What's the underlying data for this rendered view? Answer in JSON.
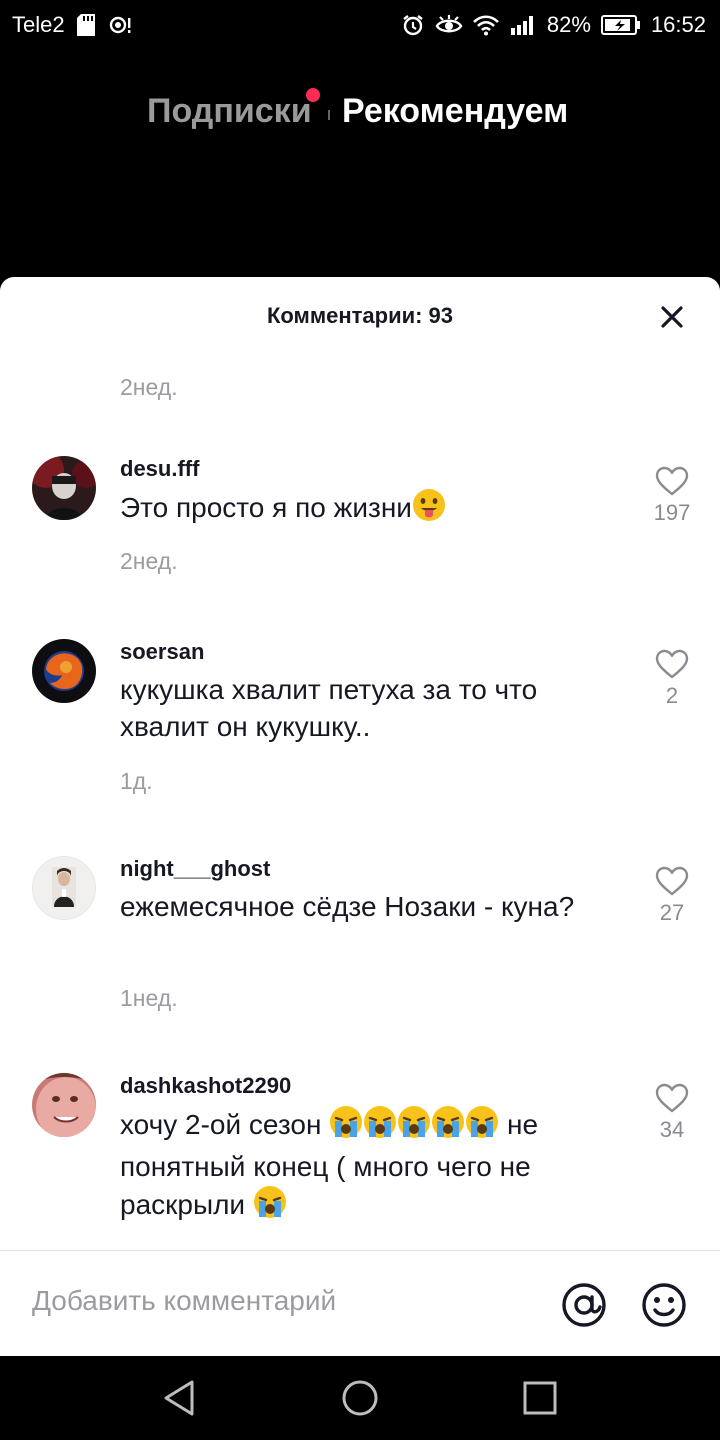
{
  "status_bar": {
    "carrier": "Tele2",
    "battery": "82%",
    "time": "16:52"
  },
  "top_nav": {
    "following_label": "Подписки",
    "for_you_label": "Рекомендуем",
    "notification_color": "#fe2c55"
  },
  "sheet": {
    "title": "Комментарии: 93",
    "previous_time": "2нед.",
    "comments": [
      {
        "username": "desu.fff",
        "text": "Это просто я по жизни",
        "emoji": "tongue",
        "likes": "197",
        "time": "2нед."
      },
      {
        "username": "soersan",
        "text": "кукушка хвалит петуха за то что хвалит он кукушку..",
        "likes": "2",
        "time": "1д."
      },
      {
        "username": "night___ghost",
        "text": "ежемесячное сёдзе Нозаки - куна?",
        "likes": "27",
        "time": "1нед."
      },
      {
        "username": "dashkashot2290",
        "text_before": "хочу 2-ой сезон",
        "text_after": "не понятный конец ( много чего не раскрыли",
        "emoji": "crying",
        "likes": "34"
      }
    ]
  },
  "input": {
    "placeholder": "Добавить комментарий",
    "mention_icon": "at-icon",
    "emoji_icon": "smiley-icon"
  },
  "colors": {
    "accent": "#fe2c55",
    "text_primary": "#161823",
    "text_secondary": "#9b9ba0"
  }
}
